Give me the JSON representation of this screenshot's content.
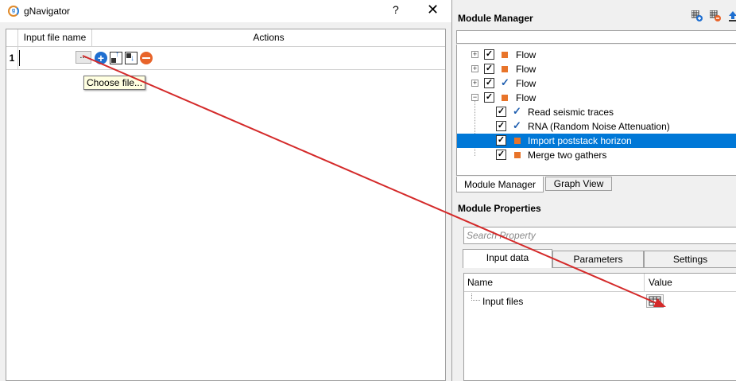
{
  "dialog": {
    "title": "gNavigator",
    "help": "?",
    "close": "✕",
    "grid": {
      "headers": [
        "Input file name",
        "Actions"
      ],
      "rows": [
        {
          "num": "1",
          "file": "",
          "browse": "..."
        }
      ]
    },
    "tooltip": "Choose file..."
  },
  "module_manager": {
    "title": "Module Manager",
    "tools": [
      "add-module-icon",
      "remove-module-icon",
      "upload-icon"
    ],
    "tree": [
      {
        "label": "Flow",
        "expander": "+",
        "status": "pending"
      },
      {
        "label": "Flow",
        "expander": "+",
        "status": "pending"
      },
      {
        "label": "Flow",
        "expander": "+",
        "status": "ok"
      },
      {
        "label": "Flow",
        "expander": "−",
        "status": "pending"
      },
      {
        "label": "Read seismic traces",
        "status": "ok"
      },
      {
        "label": "RNA (Random Noise Attenuation)",
        "status": "ok"
      },
      {
        "label": "Import poststack horizon",
        "status": "pending",
        "selected": true
      },
      {
        "label": "Merge two gathers",
        "status": "pending"
      }
    ],
    "tabs": [
      "Module Manager",
      "Graph View"
    ]
  },
  "module_properties": {
    "title": "Module Properties",
    "search_placeholder": "Search Property",
    "tabs": [
      "Input data",
      "Parameters",
      "Settings"
    ],
    "columns": [
      "Name",
      "Value"
    ],
    "rows": [
      {
        "name": "Input files"
      }
    ]
  },
  "colors": {
    "selection": "#0078d7",
    "status_pending": "#e8742a",
    "status_ok": "#1f5fb0",
    "arrow": "#d42a2a"
  }
}
